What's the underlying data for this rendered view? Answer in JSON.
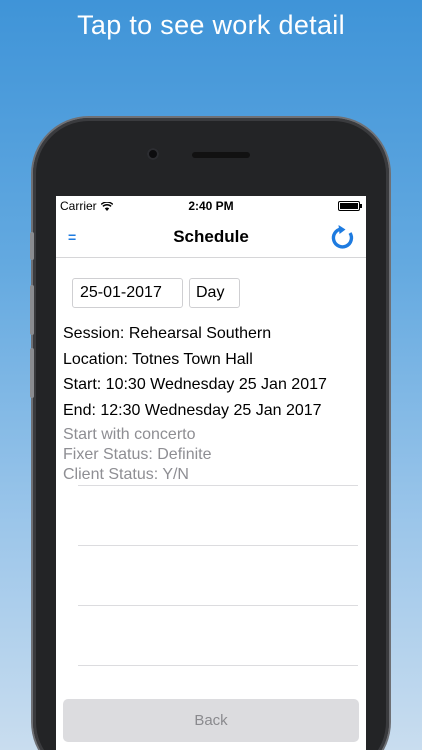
{
  "banner": {
    "text": "Tap to see work detail"
  },
  "status_bar": {
    "carrier": "Carrier",
    "time": "2:40 PM"
  },
  "nav": {
    "title": "Schedule",
    "menu_icon": "=",
    "refresh_icon": "refresh-icon"
  },
  "filters": {
    "date_value": "25-01-2017",
    "view_mode": "Day"
  },
  "event": {
    "session": "Session: Rehearsal Southern",
    "location": "Location: Totnes Town Hall",
    "start": "Start: 10:30 Wednesday 25 Jan 2017",
    "end": "End: 12:30 Wednesday 25 Jan 2017",
    "note": "Start with concerto",
    "fixer_status": "Fixer Status: Definite",
    "client_status": "Client Status: Y/N"
  },
  "footer": {
    "back_label": "Back"
  },
  "colors": {
    "accent": "#1e7be0",
    "background_top": "#3f94d8",
    "background_bottom": "#c9ddef"
  }
}
